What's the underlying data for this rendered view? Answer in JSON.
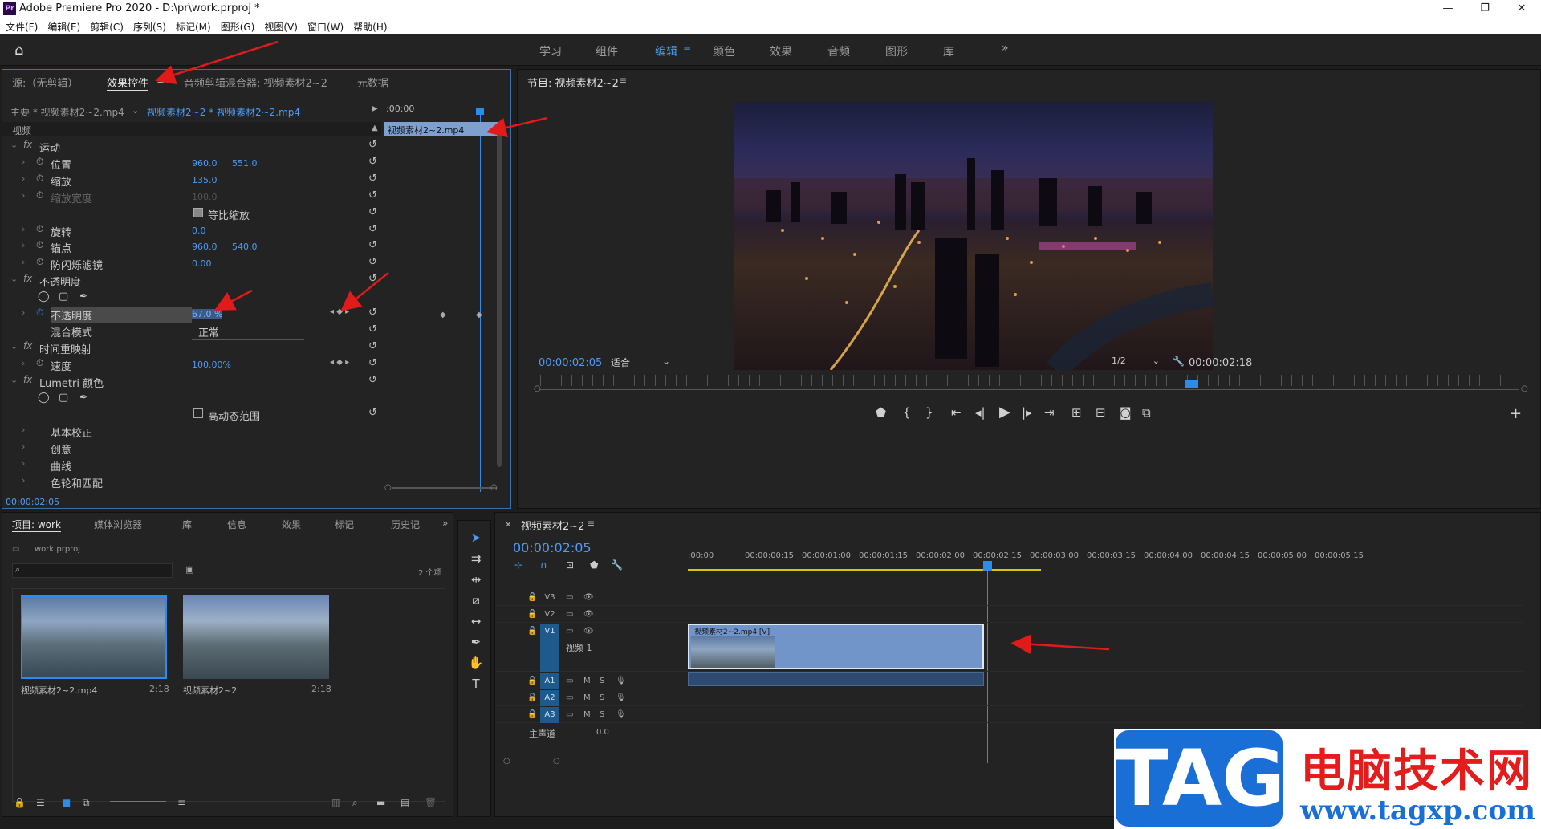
{
  "app": {
    "title": "Adobe Premiere Pro 2020 - D:\\pr\\work.prproj *",
    "logo": "Pr"
  },
  "menu": [
    "文件(F)",
    "编辑(E)",
    "剪辑(C)",
    "序列(S)",
    "标记(M)",
    "图形(G)",
    "视图(V)",
    "窗口(W)",
    "帮助(H)"
  ],
  "workspaces": [
    "学习",
    "组件",
    "编辑",
    "颜色",
    "效果",
    "音频",
    "图形",
    "库"
  ],
  "workspace_active": "编辑",
  "effects_panel": {
    "tabs": [
      "源:（无剪辑）",
      "效果控件",
      "音频剪辑混合器: 视频素材2~2",
      "元数据"
    ],
    "master": "主要 * 视频素材2~2.mp4",
    "clip": "视频素材2~2 * 视频素材2~2.mp4",
    "timecode_start": ":00:00",
    "clip_bar": "视频素材2~2.mp4",
    "section_video": "视频",
    "rows": [
      {
        "label": "运动",
        "fx": true
      },
      {
        "label": "位置",
        "v1": "960.0",
        "v2": "551.0"
      },
      {
        "label": "缩放",
        "v1": "135.0"
      },
      {
        "label": "缩放宽度",
        "v1": "100.0",
        "dim": true
      },
      {
        "label": "等比缩放",
        "check": true
      },
      {
        "label": "旋转",
        "v1": "0.0"
      },
      {
        "label": "锚点",
        "v1": "960.0",
        "v2": "540.0"
      },
      {
        "label": "防闪烁滤镜",
        "v1": "0.00"
      },
      {
        "label": "不透明度",
        "fx": true
      },
      {
        "label": "",
        "shapes": true
      },
      {
        "label": "不透明度",
        "v1": "67.0 %",
        "highlight": true
      },
      {
        "label": "混合模式",
        "select": "正常"
      },
      {
        "label": "时间重映射",
        "fx": true
      },
      {
        "label": "速度",
        "v1": "100.00%"
      },
      {
        "label": "Lumetri 颜色",
        "fx": true
      },
      {
        "label": "",
        "shapes": true
      },
      {
        "label": "高动态范围",
        "check": false
      },
      {
        "label": "基本校正"
      },
      {
        "label": "创意"
      },
      {
        "label": "曲线"
      },
      {
        "label": "色轮和匹配"
      }
    ],
    "timecode": "00:00:02:05"
  },
  "program": {
    "title": "节目: 视频素材2~2",
    "timecode": "00:00:02:05",
    "fit": "适合",
    "res": "1/2",
    "duration": "00:00:02:18"
  },
  "project": {
    "tabs": [
      "项目: work",
      "媒体浏览器",
      "库",
      "信息",
      "效果",
      "标记",
      "历史记"
    ],
    "file": "work.prproj",
    "count": "2 个项",
    "items": [
      {
        "name": "视频素材2~2.mp4",
        "dur": "2:18"
      },
      {
        "name": "视频素材2~2",
        "dur": "2:18"
      }
    ]
  },
  "timeline": {
    "title": "视频素材2~2",
    "timecode": "00:00:02:05",
    "ruler": [
      ":00:00",
      "00:00:00:15",
      "00:00:01:00",
      "00:00:01:15",
      "00:00:02:00",
      "00:00:02:15",
      "00:00:03:00",
      "00:00:03:15",
      "00:00:04:00",
      "00:00:04:15",
      "00:00:05:00",
      "00:00:05:15"
    ],
    "tracks": [
      "V3",
      "V2",
      "V1",
      "A1",
      "A2",
      "A3"
    ],
    "v1_name": "视频 1",
    "master": "主声道",
    "master_val": "0.0",
    "clip": "视频素材2~2.mp4 [V]"
  },
  "watermark": {
    "tag": "TAG",
    "cn": "电脑技术网",
    "url": "www.tagxp.com"
  },
  "colors": {
    "accent": "#2d8ceb",
    "clip": "#7195c9",
    "arrow": "#e11a1a"
  }
}
